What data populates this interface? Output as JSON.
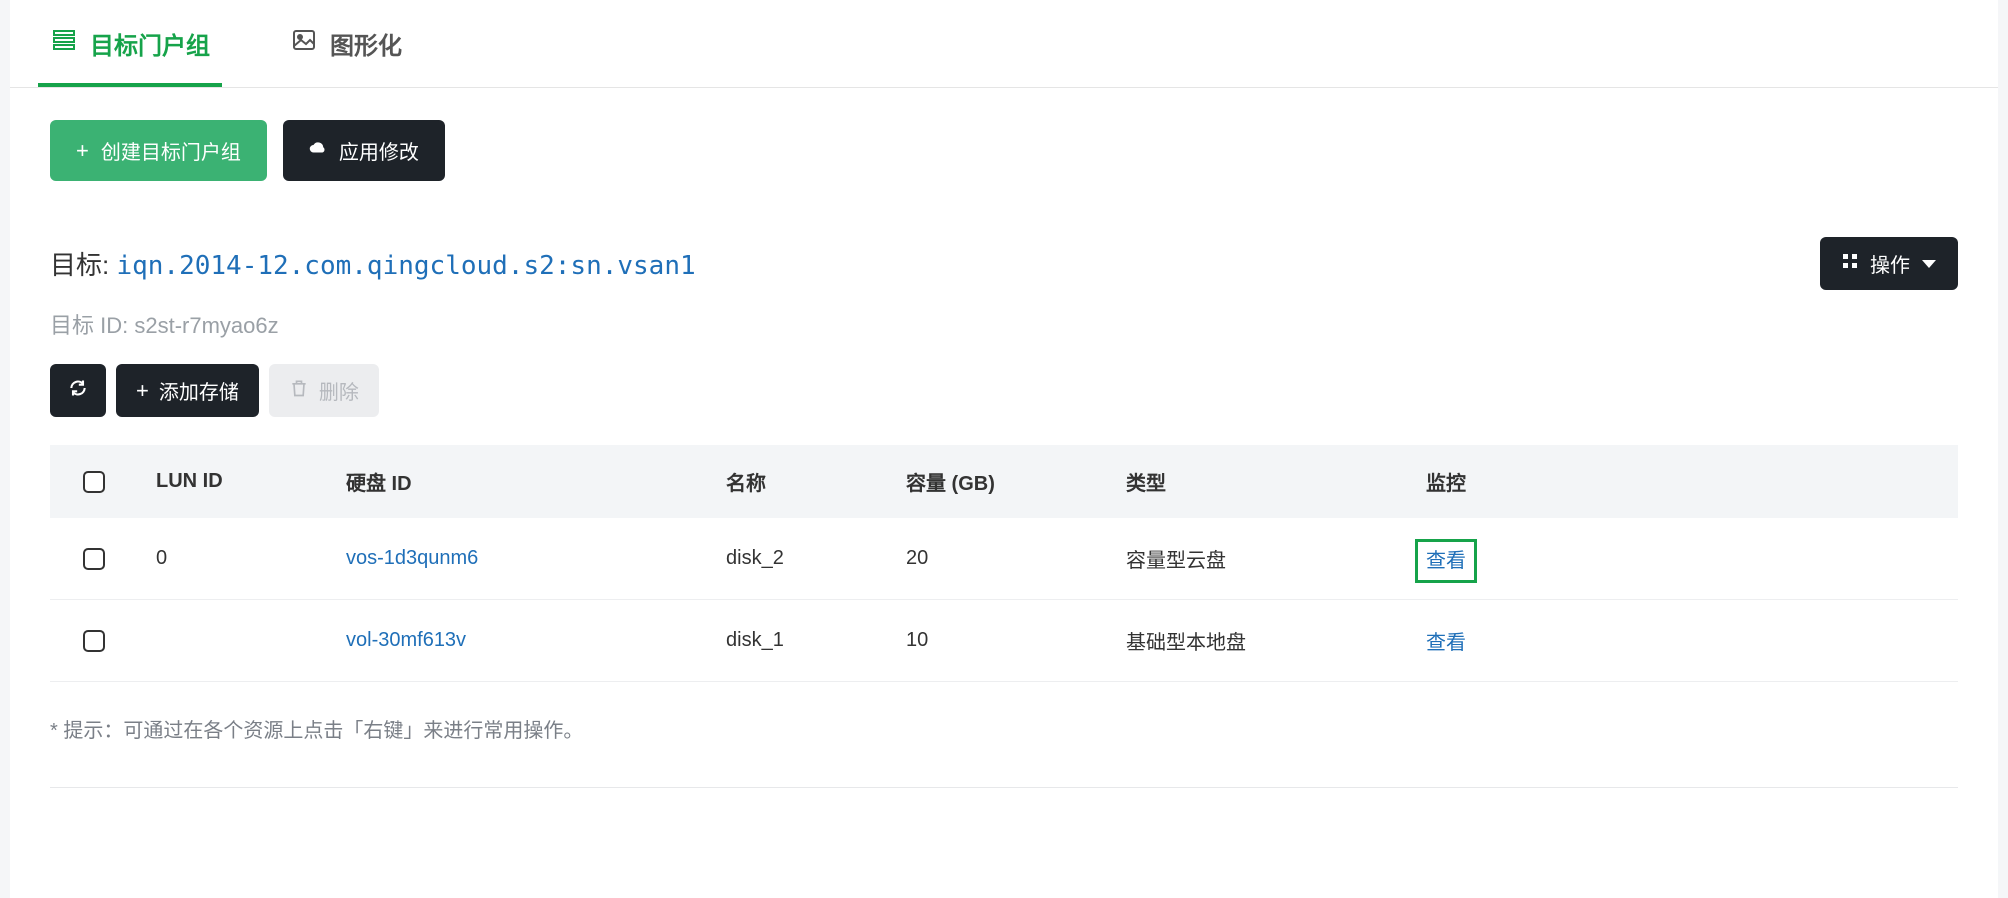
{
  "tabs": {
    "target_group": "目标门户组",
    "visual": "图形化"
  },
  "toolbar": {
    "create_label": "创建目标门户组",
    "apply_label": "应用修改"
  },
  "target": {
    "label": "目标:",
    "iqn": "iqn.2014-12.com.qingcloud.s2:sn.vsan1",
    "id_label": "目标 ID:",
    "id_value": "s2st-r7myao6z",
    "ops_label": "操作"
  },
  "subtoolbar": {
    "add_storage": "添加存储",
    "delete": "删除"
  },
  "table": {
    "headers": {
      "lun_id": "LUN ID",
      "disk_id": "硬盘 ID",
      "name": "名称",
      "capacity": "容量 (GB)",
      "type": "类型",
      "monitor": "监控"
    },
    "rows": [
      {
        "lun_id": "0",
        "disk_id": "vos-1d3qunm6",
        "name": "disk_2",
        "capacity": "20",
        "type": "容量型云盘",
        "monitor": "查看",
        "highlight": true
      },
      {
        "lun_id": "",
        "disk_id": "vol-30mf613v",
        "name": "disk_1",
        "capacity": "10",
        "type": "基础型本地盘",
        "monitor": "查看",
        "highlight": false
      }
    ]
  },
  "hint": "* 提示：可通过在各个资源上点击「右键」来进行常用操作。"
}
